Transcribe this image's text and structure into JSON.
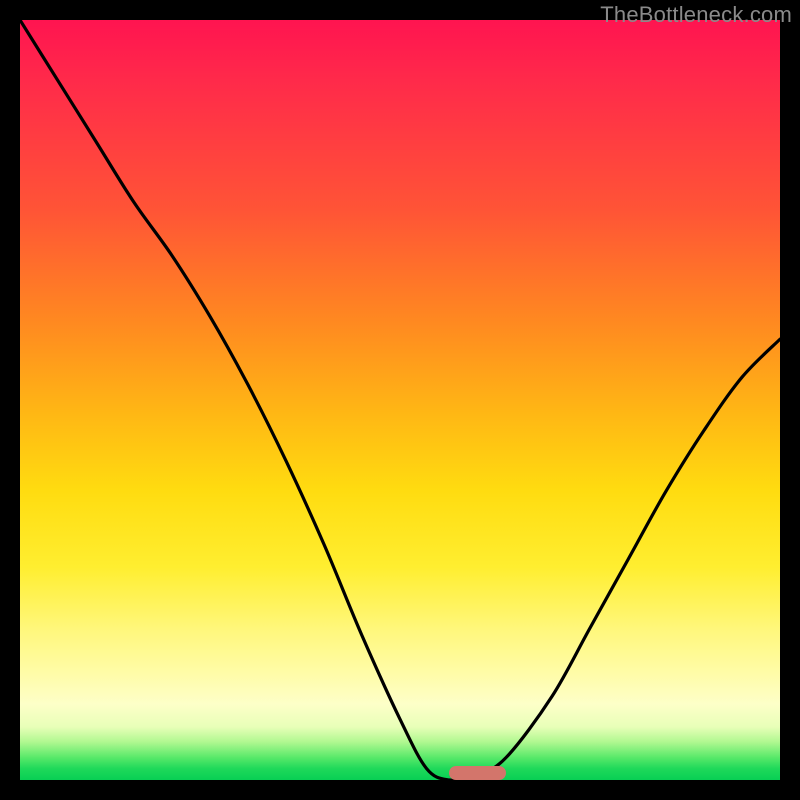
{
  "watermark": "TheBottleneck.com",
  "marker": {
    "x_frac": 0.565,
    "width_frac": 0.075
  },
  "chart_data": {
    "type": "line",
    "title": "",
    "xlabel": "",
    "ylabel": "",
    "xlim": [
      0,
      1
    ],
    "ylim": [
      0,
      1
    ],
    "series": [
      {
        "name": "bottleneck-curve",
        "x": [
          0.0,
          0.05,
          0.1,
          0.15,
          0.2,
          0.25,
          0.3,
          0.35,
          0.4,
          0.45,
          0.5,
          0.535,
          0.565,
          0.6,
          0.64,
          0.7,
          0.75,
          0.8,
          0.85,
          0.9,
          0.95,
          1.0
        ],
        "y": [
          1.0,
          0.92,
          0.84,
          0.76,
          0.69,
          0.61,
          0.52,
          0.42,
          0.31,
          0.19,
          0.08,
          0.015,
          0.0,
          0.005,
          0.03,
          0.11,
          0.2,
          0.29,
          0.38,
          0.46,
          0.53,
          0.58
        ]
      }
    ],
    "annotations": [
      {
        "type": "marker",
        "text": "optimal-range",
        "x_center_frac": 0.6,
        "width_frac": 0.075
      }
    ]
  }
}
